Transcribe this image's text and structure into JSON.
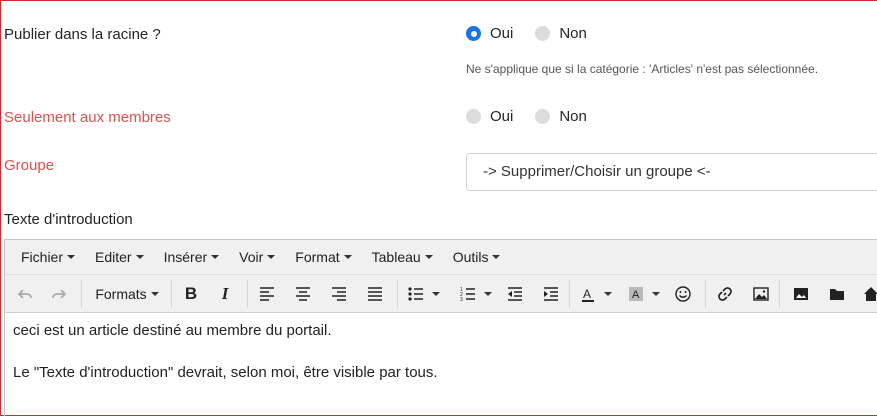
{
  "form": {
    "publish_root": {
      "label": "Publier dans la racine ?",
      "options": [
        "Oui",
        "Non"
      ],
      "selected": "Oui",
      "help": "Ne s'applique que si la catégorie : 'Articles' n'est pas sélectionnée."
    },
    "members_only": {
      "label": "Seulement aux membres",
      "options": [
        "Oui",
        "Non"
      ],
      "selected": null
    },
    "group": {
      "label": "Groupe",
      "value": "-> Supprimer/Choisir un groupe <-"
    },
    "intro_label": "Texte d'introduction"
  },
  "editor": {
    "menus": [
      "Fichier",
      "Editer",
      "Insérer",
      "Voir",
      "Format",
      "Tableau",
      "Outils"
    ],
    "formats_label": "Formats",
    "paragraphs": [
      "ceci est un article destiné au membre du portail.",
      "Le \"Texte d'introduction\" devrait, selon moi, être visible par tous."
    ]
  },
  "colors": {
    "accent": "#1a73e8",
    "required_label": "#d9534f",
    "frame_border": "#d9262b"
  }
}
